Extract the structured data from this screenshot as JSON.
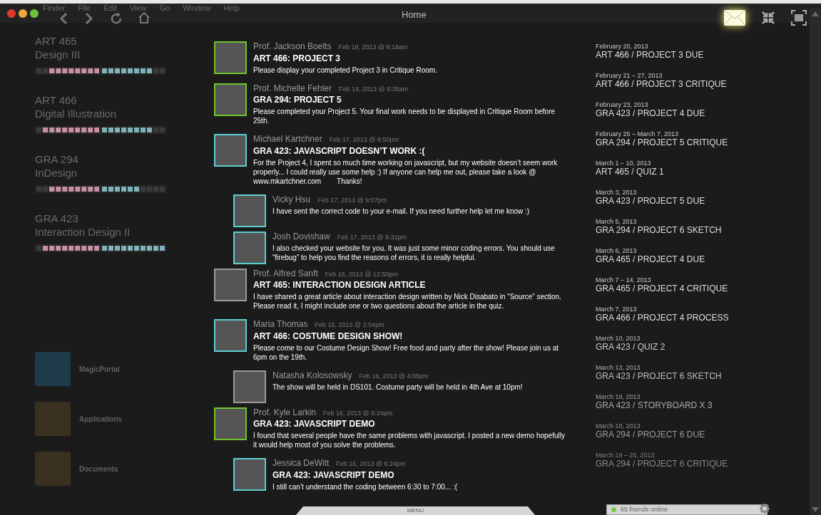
{
  "menu_bar": [
    "Finder",
    "File",
    "Edit",
    "View",
    "Go",
    "Window",
    "Help"
  ],
  "window": {
    "title": "Home"
  },
  "courses": [
    {
      "code": "ART 465",
      "name": "Design III",
      "progress": [
        {
          "color": "#c98fa3",
          "level": 0.8
        },
        {
          "color": "#7fb3ba",
          "level": 0.8
        }
      ]
    },
    {
      "code": "ART 466",
      "name": "Digital Illustration",
      "progress": [
        {
          "color": "#c98fa3",
          "level": 0.9
        },
        {
          "color": "#7fb3ba",
          "level": 0.8
        }
      ]
    },
    {
      "code": "GRA 294",
      "name": "InDesign",
      "progress": [
        {
          "color": "#c98fa3",
          "level": 0.8
        },
        {
          "color": "#7fb3ba",
          "level": 0.6
        }
      ]
    },
    {
      "code": "GRA 423",
      "name": "Interaction Design II",
      "progress": [
        {
          "color": "#c98fa3",
          "level": 0.9
        },
        {
          "color": "#7fb3ba",
          "level": 1
        }
      ]
    }
  ],
  "dock": [
    "MagicPortal",
    "Applications",
    "Documents"
  ],
  "messages": [
    {
      "author": "Prof. Jackson Boelts",
      "time": "Feb 18, 2013 @ 9:18am",
      "color": "#6fc62a",
      "title": "ART 466: PROJECT 3",
      "body": "Please display your completed Project 3 in Critique Room."
    },
    {
      "author": "Prof. Michelle Fehler",
      "time": "Feb 18, 2013 @ 8:35am",
      "color": "#6fc62a",
      "title": "GRA 294: PROJECT 5",
      "body": "Please completed your Project 5. Your final work needs to be displayed in Critique Room before 25th."
    },
    {
      "author": "Michael Kartchner",
      "time": "Feb 17, 2013 @ 8:50pm",
      "color": "#5ccfd2",
      "title": "GRA 423: JAVASCRIPT DOESN’T WORK :(",
      "body": "For the Project 4, I spent so much time working on javascript, but my website doesn’t seem work properly... I could really use some help :) If anyone can help me out, please take a look @ www.mkartchner.com        Thanks!",
      "children": [
        {
          "author": "Vicky Hsu",
          "time": "Feb 17, 2013 @ 9:07pm",
          "color": "#5ccfd2",
          "body": "I have sent the correct code to your e-mail. If you need further help let me know :)"
        },
        {
          "author": "Josh Dovishaw",
          "time": "Feb 17, 2013 @ 9:31pm",
          "color": "#5ccfd2",
          "body": "I also checked your website for you. It was just some minor coding errors. You should use “firebug” to help you find the reasons of errors, it is really helpful."
        }
      ]
    },
    {
      "author": "Prof. Alfred Sanft",
      "time": "Feb 16, 2013 @ 12:50pm",
      "color": "#9a9a9a",
      "title": "ART 465: INTERACTION DESIGN ARTICLE",
      "body": "I have shared a great article about interaction design written by Nick Disabato in “Source” section. Please read it, I might include one or two questions about the article in the quiz."
    },
    {
      "author": "Maria Thomas",
      "time": "Feb 16, 2013 @ 2:04pm",
      "color": "#5ccfd2",
      "title": "ART 466: COSTUME DESIGN SHOW!",
      "body": "Please come to our Costume Design Show! Free food and party after the show! Please join us at 6pm on the 19th.",
      "children": [
        {
          "author": "Natasha Kolosowsky",
          "time": "Feb 16, 2013 @ 4:05pm",
          "color": "#9a9a9a",
          "body": "The show will be held in DS101. Costume party will be held in 4th Ave at 10pm!"
        }
      ]
    },
    {
      "author": "Prof. Kyle Larkin",
      "time": "Feb 16, 2013 @ 6:24pm",
      "color": "#6fc62a",
      "title": "GRA 423: JAVASCRIPT DEMO",
      "body": "I found that several people have the same problems with javascript. I posted a new demo hopefully it would help most of you solve the problems.",
      "children": [
        {
          "author": "Jessica DeWitt",
          "time": "Feb 16, 2013 @ 6:24pm",
          "color": "#5ccfd2",
          "title": "GRA 423: JAVASCRIPT DEMO",
          "body": "I still can’t understand the coding between 6:30 to 7:00... :("
        }
      ]
    }
  ],
  "deadlines": [
    {
      "date": "February 20, 2013",
      "task": "ART 466 / PROJECT 3 DUE"
    },
    {
      "date": "February 21 – 27, 2013",
      "task": "ART 466 / PROJECT 3 CRITIQUE"
    },
    {
      "date": "February 23, 2013",
      "task": "GRA 423 / PROJECT 4 DUE"
    },
    {
      "date": "February 25 – March 7, 2013",
      "task": "GRA 294 / PROJECT 5 CRITIQUE"
    },
    {
      "date": "March 1 – 10, 2013",
      "task": "ART 465 / QUIZ 1"
    },
    {
      "date": "March 3, 2013",
      "task": "GRA 423 / PROJECT 5 DUE"
    },
    {
      "date": "March 5, 2013",
      "task": "GRA 294 / PROJECT 6 SKETCH"
    },
    {
      "date": "March 6, 2013",
      "task": "GRA 465 / PROJECT 4 DUE"
    },
    {
      "date": "March 7 – 14, 2013",
      "task": "GRA 465 / PROJECT 4 CRITIQUE"
    },
    {
      "date": "March 7, 2013",
      "task": "GRA 466 / PROJECT 4 PROCESS"
    },
    {
      "date": "March 10, 2013",
      "task": "GRA 423 / QUIZ 2"
    },
    {
      "date": "March 13, 2013",
      "task": "GRA 423 / PROJECT 6 SKETCH"
    },
    {
      "date": "March 18, 2013",
      "task": "GRA 423 / STORYBOARD X 3"
    },
    {
      "date": "March 18, 2013",
      "task": "GRA 294 / PROJECT 6 DUE"
    },
    {
      "date": "March 19 – 25, 2013",
      "task": "GRA 294 / PROJECT 6 CRITIQUE"
    }
  ],
  "menu_tab": "MENU",
  "friends": {
    "label": "65 friends online",
    "color": "#7ac943"
  }
}
